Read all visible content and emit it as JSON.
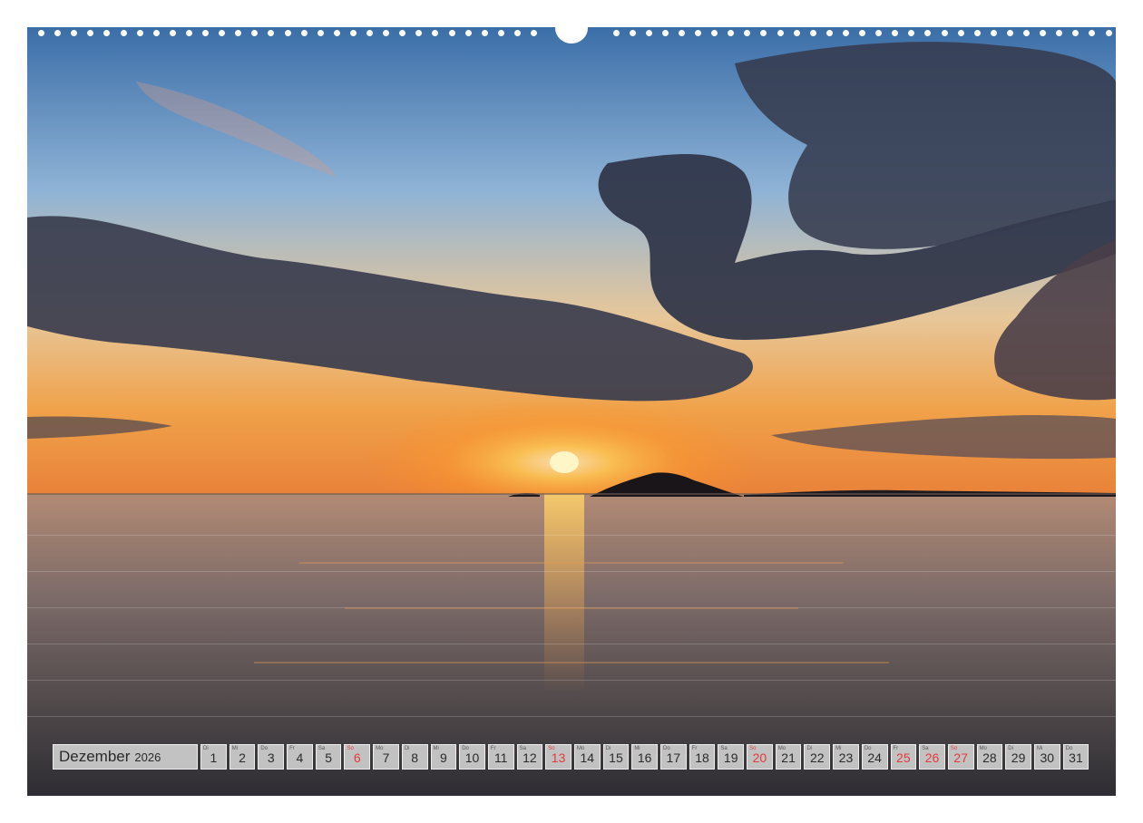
{
  "calendar": {
    "month": "Dezember",
    "year": "2026",
    "days": [
      {
        "wd": "Di",
        "n": "1"
      },
      {
        "wd": "Mi",
        "n": "2"
      },
      {
        "wd": "Do",
        "n": "3"
      },
      {
        "wd": "Fr",
        "n": "4"
      },
      {
        "wd": "Sa",
        "n": "5"
      },
      {
        "wd": "So",
        "n": "6",
        "type": "sunday"
      },
      {
        "wd": "Mo",
        "n": "7"
      },
      {
        "wd": "Di",
        "n": "8"
      },
      {
        "wd": "Mi",
        "n": "9"
      },
      {
        "wd": "Do",
        "n": "10"
      },
      {
        "wd": "Fr",
        "n": "11"
      },
      {
        "wd": "Sa",
        "n": "12"
      },
      {
        "wd": "So",
        "n": "13",
        "type": "sunday"
      },
      {
        "wd": "Mo",
        "n": "14"
      },
      {
        "wd": "Di",
        "n": "15"
      },
      {
        "wd": "Mi",
        "n": "16"
      },
      {
        "wd": "Do",
        "n": "17"
      },
      {
        "wd": "Fr",
        "n": "18"
      },
      {
        "wd": "Sa",
        "n": "19"
      },
      {
        "wd": "So",
        "n": "20",
        "type": "sunday"
      },
      {
        "wd": "Mo",
        "n": "21"
      },
      {
        "wd": "Di",
        "n": "22"
      },
      {
        "wd": "Mi",
        "n": "23"
      },
      {
        "wd": "Do",
        "n": "24"
      },
      {
        "wd": "Fr",
        "n": "25",
        "type": "holiday"
      },
      {
        "wd": "Sa",
        "n": "26",
        "type": "holiday"
      },
      {
        "wd": "So",
        "n": "27",
        "type": "sunday"
      },
      {
        "wd": "Mo",
        "n": "28"
      },
      {
        "wd": "Di",
        "n": "29"
      },
      {
        "wd": "Mi",
        "n": "30"
      },
      {
        "wd": "Do",
        "n": "31"
      }
    ]
  },
  "colors": {
    "accent_red": "#e23a3a",
    "cell_background": "#e0e0e0",
    "sky_top": "#3b6ea8",
    "horizon_glow": "#f0a24a",
    "sea": "#4a4446"
  }
}
